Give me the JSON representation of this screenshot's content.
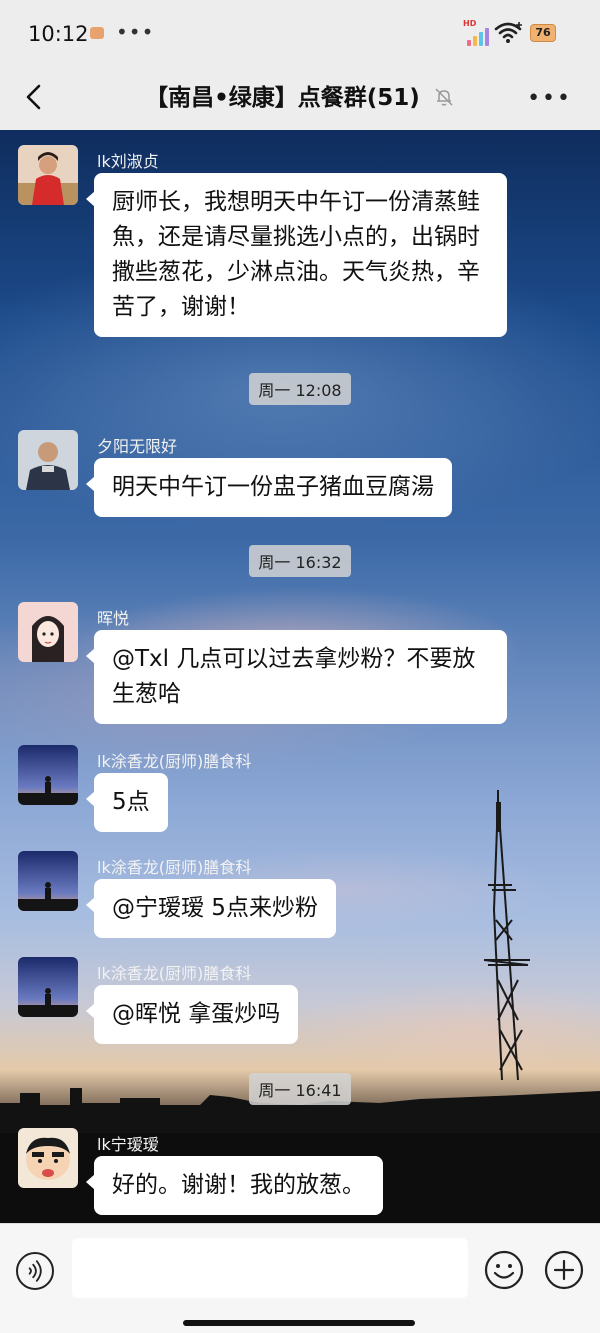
{
  "status_bar": {
    "time": "10:12",
    "more": "•••",
    "network_label": "HD",
    "battery": "76"
  },
  "nav": {
    "title": "【南昌•绿康】点餐群(51)",
    "more": "•••"
  },
  "messages": [
    {
      "sender": "lk刘淑贞",
      "text": "厨师长，我想明天中午订一份清蒸鲑魚，还是请尽量挑选小点的，出锅时撒些葱花，少淋点油。天气炎热，辛苦了，谢谢！"
    },
    {
      "sender": "夕阳无限好",
      "text": "明天中午订一份盅子猪血豆腐湯"
    },
    {
      "sender": "晖悦",
      "text": "@Txl  几点可以过去拿炒粉？不要放生葱哈"
    },
    {
      "sender": "lk涂香龙(厨师)膳食科",
      "text": "5点"
    },
    {
      "sender": "lk涂香龙(厨师)膳食科",
      "text": "@宁瑷瑷  5点来炒粉"
    },
    {
      "sender": "lk涂香龙(厨师)膳食科",
      "text": "@晖悦   拿蛋炒吗"
    },
    {
      "sender": "lk宁瑷瑷",
      "text": "好的。谢谢！我的放葱。"
    }
  ],
  "timestamps": [
    "周一 12:08",
    "周一 16:32",
    "周一 16:41"
  ],
  "icons": {
    "back": "chevron-left-icon",
    "mute": "bell-slash-icon",
    "voice": "voice-icon",
    "emoji": "smiley-icon",
    "plus": "plus-circle-icon"
  },
  "colors": {
    "bubble": "#ffffff",
    "sender_name": "#f2f2f2",
    "background": "#ededed"
  }
}
